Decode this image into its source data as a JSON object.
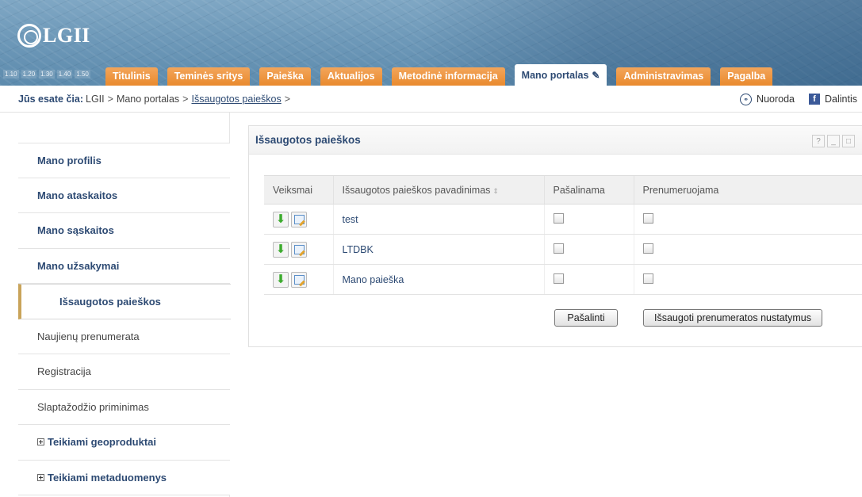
{
  "header": {
    "logo_text": "LGII",
    "zoom_levels": [
      "1.10",
      "1.20",
      "1.30",
      "1.40",
      "1.50"
    ],
    "tabs": [
      {
        "label": "Titulinis"
      },
      {
        "label": "Teminės sritys"
      },
      {
        "label": "Paieška"
      },
      {
        "label": "Aktualijos"
      },
      {
        "label": "Metodinė informacija"
      },
      {
        "label": "Mano portalas"
      },
      {
        "label": "Administravimas"
      },
      {
        "label": "Pagalba"
      }
    ],
    "active_tab": "Mano portalas"
  },
  "breadcrumb": {
    "label": "Jūs esate čia:",
    "items": [
      "LGII",
      "Mano portalas",
      "Išsaugotos paieškos"
    ],
    "separator": ">",
    "link_label": "Nuoroda",
    "share_label": "Dalintis"
  },
  "sidebar": {
    "items": [
      {
        "label": "Mano profilis"
      },
      {
        "label": "Mano ataskaitos"
      },
      {
        "label": "Mano sąskaitos"
      },
      {
        "label": "Mano užsakymai"
      },
      {
        "label": "Išsaugotos paieškos"
      },
      {
        "label": "Naujienų prenumerata"
      },
      {
        "label": "Registracija"
      },
      {
        "label": "Slaptažodžio priminimas"
      },
      {
        "label": "Teikiami geoproduktai"
      },
      {
        "label": "Teikiami metaduomenys"
      }
    ]
  },
  "portlet": {
    "title": "Išsaugotos paieškos",
    "controls": [
      "?",
      "_",
      "□"
    ],
    "columns": [
      "Veiksmai",
      "Išsaugotos paieškos pavadinimas",
      "Pašalinama",
      "Prenumeruojama"
    ],
    "rows": [
      {
        "name": "test",
        "remove": false,
        "subscribe": false
      },
      {
        "name": "LTDBK",
        "remove": false,
        "subscribe": false
      },
      {
        "name": "Mano paieška",
        "remove": false,
        "subscribe": false
      }
    ],
    "remove_button": "Pašalinti",
    "save_button": "Išsaugoti prenumeratos nustatymus"
  },
  "colors": {
    "tab_orange": "#e98a2e",
    "link_blue": "#2d4a73",
    "active_marker": "#c9a45a"
  }
}
